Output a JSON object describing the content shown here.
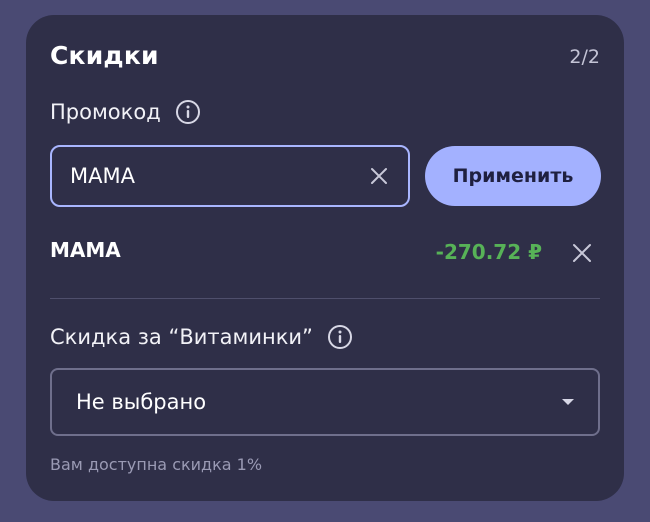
{
  "discounts": {
    "title": "Скидки",
    "counter": "2/2",
    "promo": {
      "label": "Промокод",
      "input_value": "МАМА",
      "apply_label": "Применить",
      "applied": {
        "code": "МАМА",
        "amount": "-270.72 ₽"
      }
    },
    "vitamin": {
      "label": "Скидка за “Витаминки”",
      "selected": "Не выбрано",
      "hint": "Вам доступна скидка 1%"
    }
  },
  "colors": {
    "background": "#4a4a73",
    "card": "#2f2f48",
    "accent": "#a3b1ff",
    "discount_green": "#57b257"
  }
}
